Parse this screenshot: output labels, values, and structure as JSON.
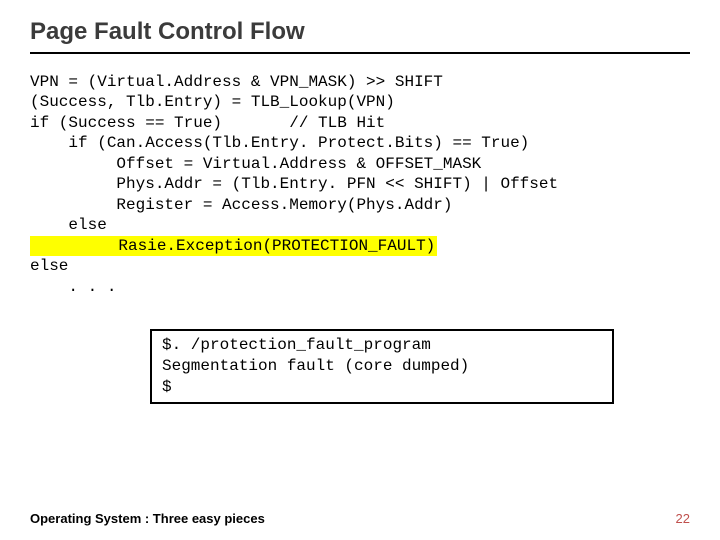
{
  "title": "Page Fault Control Flow",
  "code": {
    "l1": "VPN = (Virtual.Address & VPN_MASK) >> SHIFT",
    "l2": "(Success, Tlb.Entry) = TLB_Lookup(VPN)",
    "l3": "if (Success == True)       // TLB Hit",
    "l4": "    if (Can.Access(Tlb.Entry. Protect.Bits) == True)",
    "l5": "         Offset = Virtual.Address & OFFSET_MASK",
    "l6": "         Phys.Addr = (Tlb.Entry. PFN << SHIFT) | Offset",
    "l7": "         Register = Access.Memory(Phys.Addr)",
    "l8": "    else",
    "l9_hl": "         Rasie.Exception(PROTECTION_FAULT)",
    "l10": "else",
    "l11": "    . . ."
  },
  "terminal": {
    "line1": "$. /protection_fault_program",
    "line2": "Segmentation fault (core dumped)",
    "line3": "$"
  },
  "footer": "Operating System : Three easy pieces",
  "page_number": "22"
}
